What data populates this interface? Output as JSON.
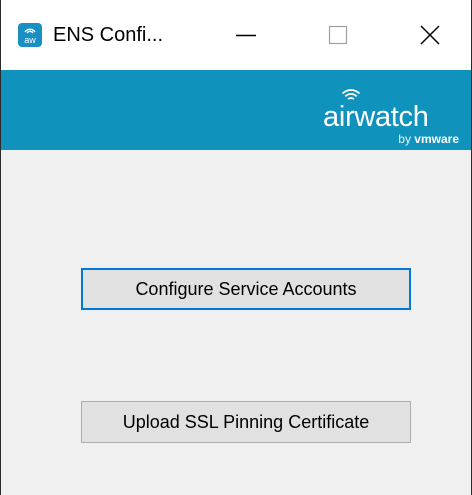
{
  "window": {
    "title": "ENS Confi...",
    "controls": {
      "minimize": "minimize",
      "maximize": "maximize",
      "close": "close"
    }
  },
  "banner": {
    "brand": "airwatch",
    "by": "by",
    "vendor": "vmware",
    "color": "#0f93bd"
  },
  "buttons": {
    "configure_service_accounts": "Configure Service Accounts",
    "upload_ssl_pinning_certificate": "Upload SSL Pinning Certificate"
  },
  "colors": {
    "focus_border": "#0078d7",
    "button_face": "#e1e1e1",
    "window_bg": "#f0f0f0"
  }
}
